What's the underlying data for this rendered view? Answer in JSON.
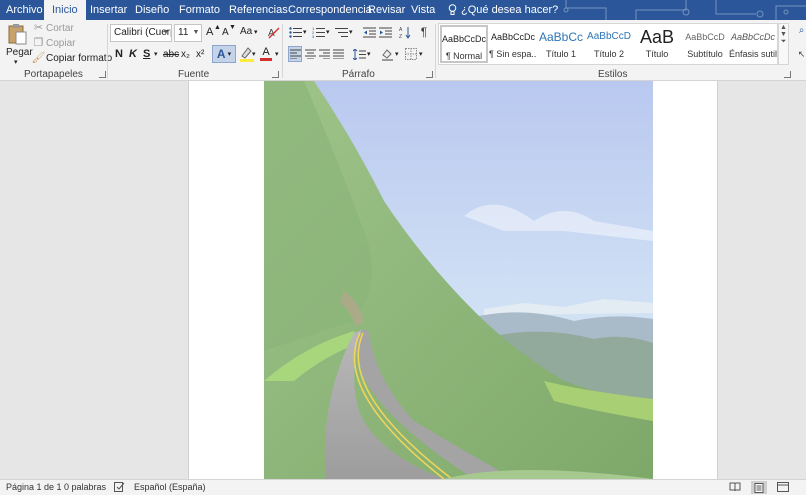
{
  "tabs": [
    {
      "label": "Archivo",
      "active": false
    },
    {
      "label": "Inicio",
      "active": true
    },
    {
      "label": "Insertar",
      "active": false
    },
    {
      "label": "Diseño",
      "active": false
    },
    {
      "label": "Formato",
      "active": false
    },
    {
      "label": "Referencias",
      "active": false
    },
    {
      "label": "Correspondencia",
      "active": false
    },
    {
      "label": "Revisar",
      "active": false
    },
    {
      "label": "Vista",
      "active": false
    }
  ],
  "tell_me": {
    "label": "¿Qué desea hacer?",
    "icon": "lightbulb-icon"
  },
  "clipboard": {
    "paste_label": "Pegar",
    "cut_label": "Cortar",
    "copy_label": "Copiar",
    "format_painter_label": "Copiar formato",
    "group_label": "Portapapeles"
  },
  "font": {
    "family": "Calibri (Cuerpo)",
    "size": "11",
    "grow_label": "A",
    "shrink_label": "A",
    "case_label": "Aa",
    "bold": "N",
    "italic": "K",
    "underline": "S",
    "strike": "abc",
    "subscript": "x₂",
    "superscript": "x²",
    "effects_label": "A",
    "color_label": "A",
    "group_label": "Fuente"
  },
  "paragraph": {
    "group_label": "Párrafo"
  },
  "styles": {
    "group_label": "Estilos",
    "items": [
      {
        "preview": "AaBbCcDc",
        "name": "¶ Normal",
        "selected": true
      },
      {
        "preview": "AaBbCcDc",
        "name": "¶ Sin espa...",
        "selected": false
      },
      {
        "preview": "AaBbCc",
        "name": "Título 1",
        "selected": false
      },
      {
        "preview": "AaBbCcD",
        "name": "Título 2",
        "selected": false
      },
      {
        "preview": "AaB",
        "name": "Título",
        "selected": false
      },
      {
        "preview": "AaBbCcD",
        "name": "Subtítulo",
        "selected": false
      },
      {
        "preview": "AaBbCcDc",
        "name": "Énfasis sutil",
        "selected": false
      }
    ]
  },
  "status": {
    "page": "Página 1 de 1",
    "words": "0 palabras",
    "language": "Español (España)"
  },
  "colors": {
    "accent": "#2b579a",
    "font_color": "#d32f2f",
    "highlight": "#ffeb3b"
  }
}
